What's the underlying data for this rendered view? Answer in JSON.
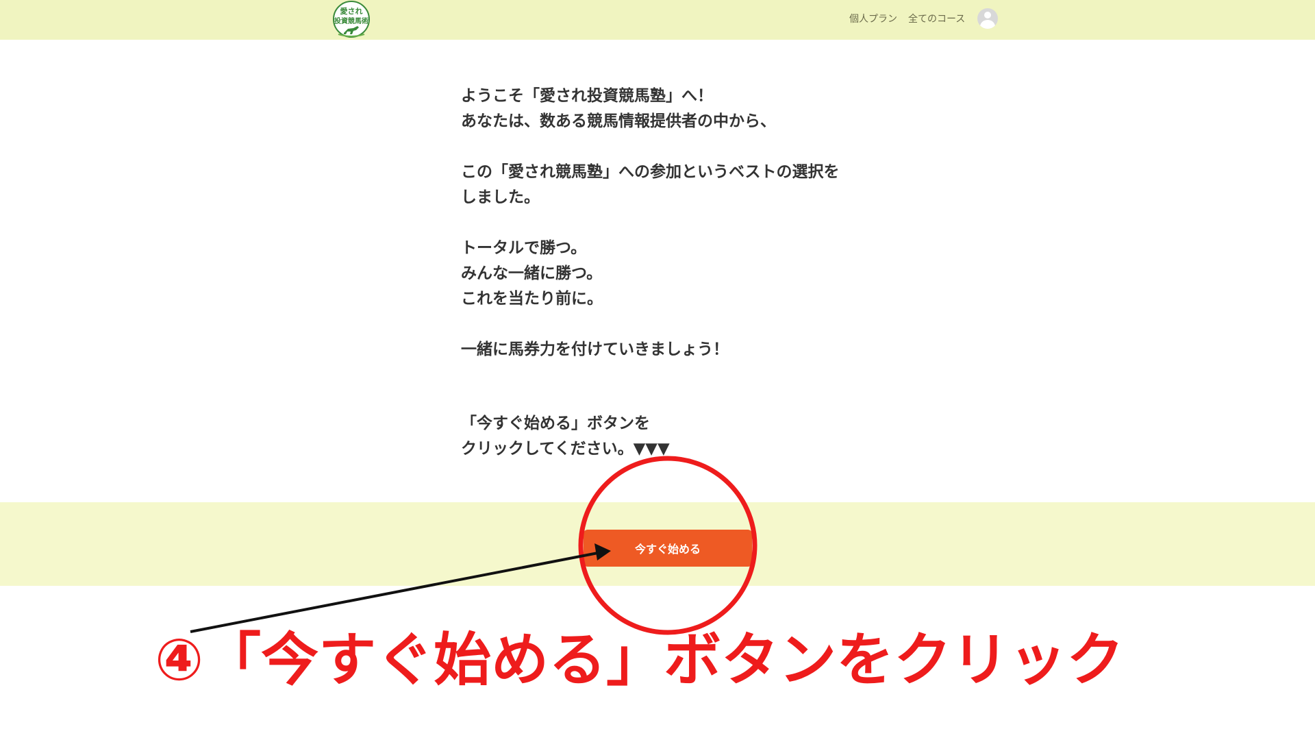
{
  "header": {
    "logo": {
      "text_line1": "愛され",
      "text_line2": "投資競馬術",
      "icon": "horse-rider-logo"
    },
    "nav": {
      "plan_label": "個人プラン",
      "courses_label": "全てのコース"
    },
    "avatar_icon": "user-avatar-icon"
  },
  "main": {
    "lines": [
      "ようこそ「愛され投資競馬塾」へ！",
      "あなたは、数ある競馬情報提供者の中から、",
      "この「愛され競馬塾」への参加というベストの選択を",
      "しました。",
      "トータルで勝つ。",
      "みんな一緒に勝つ。",
      "これを当たり前に。",
      "一緒に馬券力を付けていきましょう！",
      "「今すぐ始める」ボタンを",
      "クリックしてください。▼▼▼"
    ],
    "start_button_label": "今すぐ始める"
  },
  "annotation": {
    "caption": "④「今すぐ始める」ボタンをクリック",
    "color": "#ee1c1c"
  },
  "colors": {
    "header_bg": "#f0f4c0",
    "band_bg": "#f5f8cc",
    "button_bg": "#ee5a24",
    "logo_green": "#3a8a3a"
  }
}
